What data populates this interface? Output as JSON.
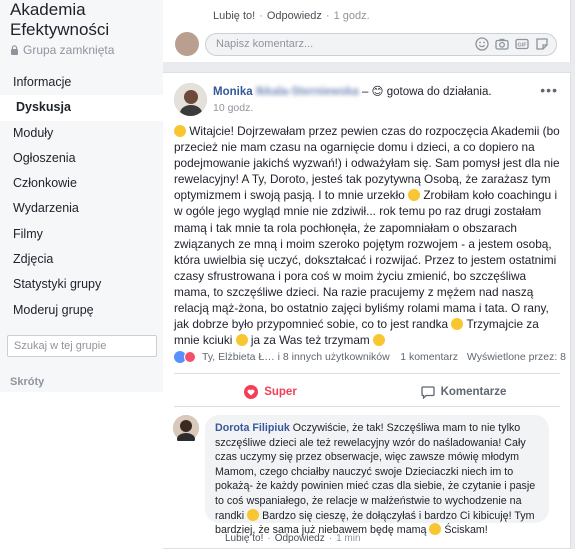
{
  "sidebar": {
    "group_name": "Akademia Efektywności",
    "group_type": "Grupa zamknięta",
    "items": [
      {
        "label": "Informacje",
        "active": false
      },
      {
        "label": "Dyskusja",
        "active": true
      },
      {
        "label": "Moduły",
        "active": false
      },
      {
        "label": "Ogłoszenia",
        "active": false
      },
      {
        "label": "Członkowie",
        "active": false
      },
      {
        "label": "Wydarzenia",
        "active": false
      },
      {
        "label": "Filmy",
        "active": false
      },
      {
        "label": "Zdjęcia",
        "active": false
      },
      {
        "label": "Statystyki grupy",
        "active": false
      },
      {
        "label": "Moderuj grupę",
        "active": false
      }
    ],
    "search_placeholder": "Szukaj w tej grupie",
    "shortcuts_title": "Skróty"
  },
  "top_comment_meta": {
    "like": "Lubię to!",
    "reply": "Odpowiedz",
    "time": "1 godz."
  },
  "composer": {
    "placeholder": "Napisz komentarz..."
  },
  "post": {
    "author": "Monika",
    "author_blurred": "Ikkala-Sterniewska",
    "feeling": "– 😊 gotowa do działania.",
    "time": "10 godz.",
    "more": "•••",
    "body": [
      "Witajcie! Dojrzewałam przez pewien czas do rozpoczęcia Akademii (bo przecież nie mam czasu na ogarnięcie domu i dzieci, a co dopiero na podejmowanie jakichś wyzwań!) i odważyłam się. Sam pomysł jest dla nie rewelacyjny! A Ty, Doroto, jesteś tak pozytywną Osobą, że zarażasz tym optymizmem i swoją pasją. I to mnie urzekło ",
      " Zrobiłam koło coachingu i w ogóle jego wygląd mnie nie zdziwił... rok temu po raz drugi zostałam mamą i tak mnie ta rola pochłonęła, że zapomniałam o obszarach związanych ze mną i moim szeroko pojętym rozwojem - a jestem osobą, która uwielbia się uczyć, dokształcać i rozwijać. Przez to jestem ostatnimi czasy sfrustrowana i pora coś w moim życiu zmienić, bo szczęśliwa mama, to szczęśliwe dzieci. Na razie pracujemy z mężem nad naszą relacją mąż-żona, bo ostatnio zajęci byliśmy rolami mama i tata. O rany, jak dobrze było przypomnieć sobie, co to jest randka ",
      " Trzymajcie za mnie kciuki ",
      " ja za Was też trzymam "
    ],
    "reactions_text": "Ty, Elżbieta Ł… i 8 innych użytkowników",
    "comments_count": "1 komentarz",
    "views": "Wyświetlone przez: 8",
    "actions": {
      "love": "Super",
      "comment": "Komentarze"
    }
  },
  "comment": {
    "author": "Dorota Filipiuk",
    "text_parts": [
      " Oczywiście, że tak! Szczęśliwa mam to nie tylko szczęśliwe dzieci ale też rewelacyjny wzór do naśladowania! Cały czas uczymy się przez obserwacje, więc zawsze mówię młodym Mamom, czego chciałby nauczyć swoje Dzieciaczki niech im to pokażą- że każdy powinien mieć czas dla siebie, że czytanie i pasje to coś wspaniałego, że relacje w małżeństwie to wychodzenie na randki ",
      " Bardzo się cieszę, że dołączyłaś i bardzo Ci kibicuję! Tym bardziej, że sama już niebawem będę mamą ",
      " Ściskam!"
    ],
    "like": "Lubię to!",
    "reply": "Odpowiedz",
    "time": "1 min"
  },
  "colors": {
    "link": "#365899",
    "love": "#f33e58",
    "sidebar_bg": "#f6f7f9"
  }
}
